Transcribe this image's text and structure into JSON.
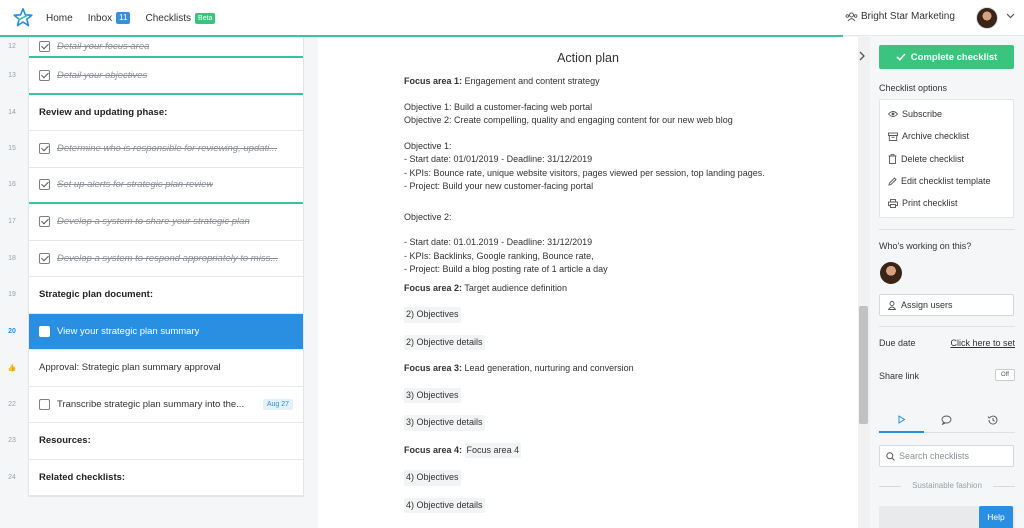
{
  "header": {
    "nav": [
      {
        "label": "Home"
      },
      {
        "label": "Inbox",
        "badge": "11"
      },
      {
        "label": "Checklists",
        "badge": "Beta"
      }
    ],
    "org_name": "Bright Star Marketing"
  },
  "tasks": [
    {
      "num": "12",
      "label": "Detail your focus area",
      "checked": true
    },
    {
      "num": "13",
      "label": "Detail your objectives",
      "checked": true
    },
    {
      "num": "14",
      "label": "Review and updating phase:",
      "heading": true
    },
    {
      "num": "15",
      "label": "Determine who is responsible for reviewing, updati...",
      "checked": true
    },
    {
      "num": "16",
      "label": "Set up alerts for strategic plan review",
      "checked": true
    },
    {
      "num": "17",
      "label": "Develop a system to share your strategic plan",
      "checked": true
    },
    {
      "num": "18",
      "label": "Develop a system to respond appropriately to miss...",
      "checked": true
    },
    {
      "num": "19",
      "label": "Strategic plan document:",
      "heading": true
    },
    {
      "num": "20",
      "label": "View your strategic plan summary",
      "active": true
    },
    {
      "num": "👍",
      "label": "Approval: Strategic plan summary approval"
    },
    {
      "num": "22",
      "label": "Transcribe strategic plan summary into the...",
      "date": "Aug 27"
    },
    {
      "num": "23",
      "label": "Resources:",
      "heading": true
    },
    {
      "num": "24",
      "label": "Related checklists:",
      "heading": true
    }
  ],
  "doc": {
    "title": "Action plan",
    "fa1_label": "Focus area 1:",
    "fa1_value": "Engagement and content strategy",
    "obj_summary_1": "Objective 1: Build a customer-facing web portal",
    "obj_summary_2": "Objective 2: Create compelling, quality and engaging content for our new web blog",
    "obj1_title": "Objective 1:",
    "obj1_dates": "- Start date: 01/01/2019 - Deadline: 31/12/2019",
    "obj1_kpis": "- KPIs: Bounce rate, unique website visitors, pages viewed per session, top landing pages.",
    "obj1_project": "- Project: Build your new customer-facing portal",
    "obj2_title": "Objective 2:",
    "obj2_dates": "- Start date: 01.01.2019 - Deadline: 31/12/2019",
    "obj2_kpis": "- KPIs: Backlinks, Google ranking, Bounce rate,",
    "obj2_project": "- Project: Build a blog posting rate of 1 article a day",
    "fa2_label": "Focus area 2:",
    "fa2_value": "Target audience definition",
    "fa2_objectives": "2) Objectives",
    "fa2_details": "2) Objective details",
    "fa3_label": "Focus area 3:",
    "fa3_value": "Lead generation, nurturing and conversion",
    "fa3_objectives": "3) Objectives",
    "fa3_details": "3) Objective details",
    "fa4_label": "Focus area 4:",
    "fa4_value": "Focus area 4",
    "fa4_objectives": "4) Objectives",
    "fa4_details": "4) Objective details"
  },
  "sidebar": {
    "complete_label": "Complete checklist",
    "options_title": "Checklist options",
    "options": [
      {
        "label": "Subscribe",
        "icon": "eye-icon"
      },
      {
        "label": "Archive checklist",
        "icon": "archive-icon"
      },
      {
        "label": "Delete checklist",
        "icon": "trash-icon"
      },
      {
        "label": "Edit checklist template",
        "icon": "pencil-icon"
      },
      {
        "label": "Print checklist",
        "icon": "printer-icon"
      }
    ],
    "working_title": "Who's working on this?",
    "assign_label": "Assign users",
    "due_label": "Due date",
    "due_link": "Click here to set",
    "share_label": "Share link",
    "share_toggle": "Off",
    "search_placeholder": "Search checklists",
    "suggest_label": "Sustainable fashion",
    "help_label": "Help"
  },
  "colors": {
    "accent_blue": "#2a8fe0",
    "success_green": "#3ac47d",
    "progress_teal": "#3ac49c"
  }
}
